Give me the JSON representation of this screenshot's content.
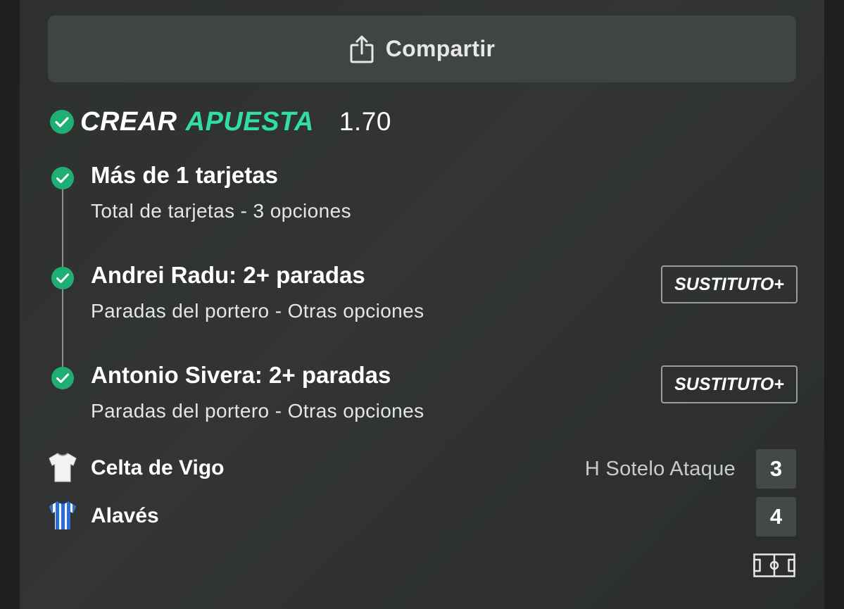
{
  "share": {
    "label": "Compartir",
    "icon": "share-icon"
  },
  "bet_builder": {
    "title_part1": "CREAR",
    "title_part2": "APUESTA",
    "odds": "1.70",
    "accent_color": "#2fe0a0",
    "check_color": "#1fae74",
    "legs": [
      {
        "title": "Más de 1 tarjetas",
        "subtitle": "Total de tarjetas - 3 opciones",
        "button": ""
      },
      {
        "title": "Andrei Radu: 2+ paradas",
        "subtitle": "Paradas del portero - Otras opciones",
        "button": "SUSTITUTO+"
      },
      {
        "title": "Antonio Sivera: 2+ paradas",
        "subtitle": "Paradas del portero - Otras opciones",
        "button": "SUSTITUTO+"
      }
    ]
  },
  "match": {
    "teams": [
      {
        "name": "Celta de Vigo",
        "info": "H Sotelo Ataque",
        "score": "3",
        "shirt_icon": "white-shirt-icon"
      },
      {
        "name": "Alavés",
        "info": "",
        "score": "4",
        "shirt_icon": "blue-striped-shirt-icon"
      }
    ],
    "pitch_icon": "pitch-icon"
  }
}
